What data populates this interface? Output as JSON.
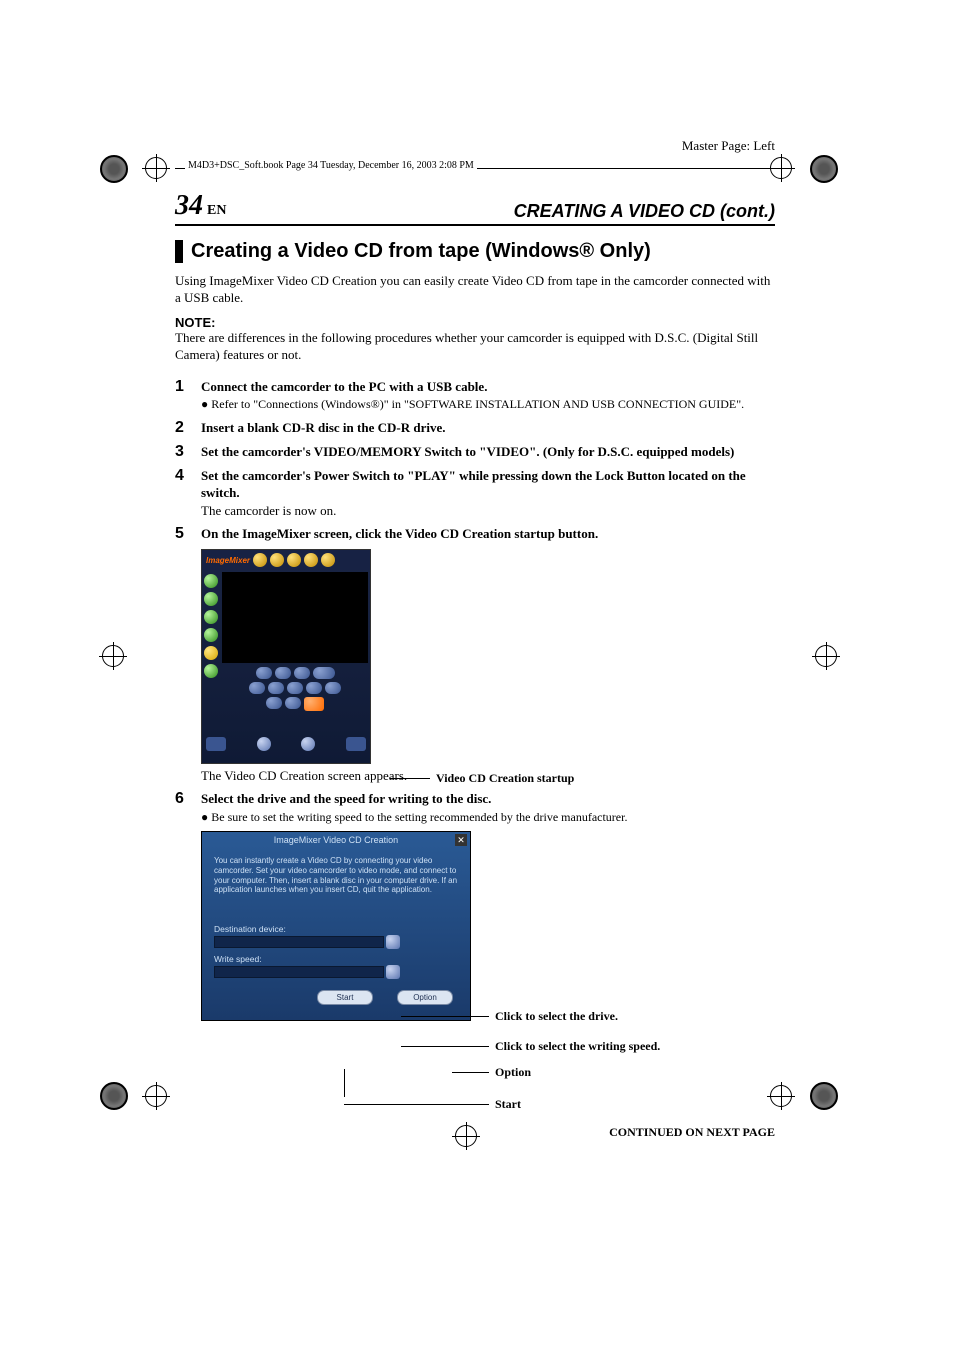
{
  "master_page": "Master Page: Left",
  "book_info": "M4D3+DSC_Soft.book  Page 34  Tuesday, December 16, 2003  2:08 PM",
  "page_number": "34",
  "lang_code": "EN",
  "section_title": "CREATING A VIDEO CD (cont.)",
  "subheading": "Creating a Video CD from tape (Windows® Only)",
  "intro": "Using ImageMixer Video CD Creation you can easily create Video CD from tape in the camcorder connected with a USB cable.",
  "note_label": "NOTE:",
  "note_text": "There are differences in the following procedures whether your camcorder is equipped with D.S.C. (Digital Still Camera) features or not.",
  "steps": {
    "s1": {
      "num": "1",
      "title": "Connect the camcorder to the PC with a USB cable.",
      "bullet": "● Refer to \"Connections (Windows®)\" in \"SOFTWARE INSTALLATION AND USB CONNECTION GUIDE\"."
    },
    "s2": {
      "num": "2",
      "title": "Insert a blank CD-R disc in the CD-R drive."
    },
    "s3": {
      "num": "3",
      "title": "Set the camcorder's VIDEO/MEMORY Switch to \"VIDEO\". (Only for D.S.C. equipped models)"
    },
    "s4": {
      "num": "4",
      "title": "Set the camcorder's Power Switch to \"PLAY\" while pressing down the Lock Button located on the switch.",
      "sub": "The camcorder is now on."
    },
    "s5": {
      "num": "5",
      "title": "On the ImageMixer screen, click the Video CD Creation startup button."
    },
    "s6": {
      "num": "6",
      "title": "Select the drive and the speed for writing to the disc.",
      "bullet": "● Be sure to set the writing speed to the setting recommended by the drive manufacturer."
    }
  },
  "after_img1": "The Video CD Creation screen appears.",
  "callout_startup": "Video CD Creation startup",
  "imagemixer_logo": "ImageMixer",
  "dialog": {
    "title": "ImageMixer Video CD Creation",
    "instr": "You can instantly create a Video CD by connecting your video camcorder.\nSet your video camcorder to video mode, and connect to your computer.\nThen, insert a blank disc in your computer drive. If an application launches when you insert CD, quit the application.",
    "dest_label": "Destination device:",
    "speed_label": "Write speed:",
    "start_btn": "Start",
    "option_btn": "Option"
  },
  "callouts": {
    "drive": "Click to select the drive.",
    "speed": "Click to select the writing speed.",
    "option": "Option",
    "start": "Start"
  },
  "continued": "CONTINUED ON NEXT PAGE"
}
